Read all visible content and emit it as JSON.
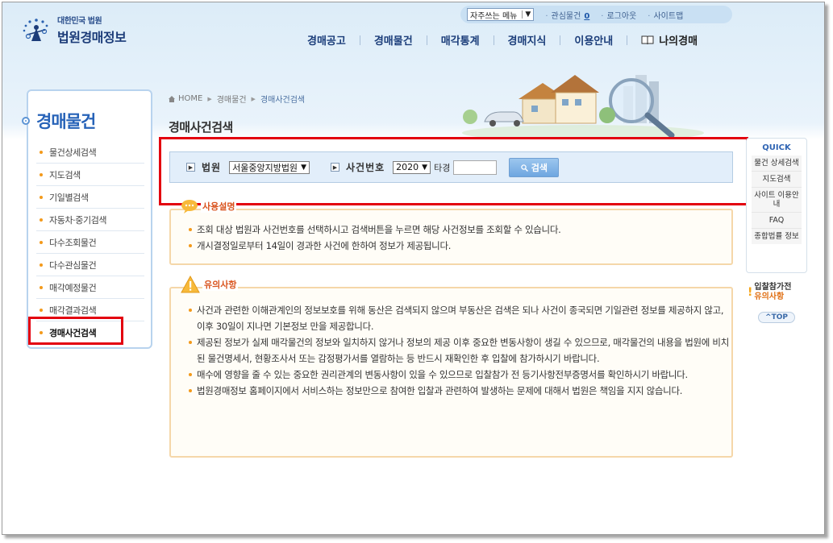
{
  "header": {
    "logo_sub": "대한민국 법원",
    "logo_main": "법원경매정보",
    "fav_menu": "자주쓰는 메뉴",
    "util": {
      "interest_label": "관심물건",
      "interest_count": "0",
      "login": "로그아웃",
      "sitemap": "사이트맵"
    },
    "gnb": [
      "경매공고",
      "경매물건",
      "매각통계",
      "경매지식",
      "이용안내",
      "나의경매"
    ]
  },
  "sidebar": {
    "title": "경매물건",
    "items": [
      "물건상세검색",
      "지도검색",
      "기일별검색",
      "자동차·중기검색",
      "다수조회물건",
      "다수관심물건",
      "매각예정물건",
      "매각결과검색",
      "경매사건검색"
    ],
    "active_index": 8
  },
  "breadcrumb": [
    "HOME",
    "경매물건",
    "경매사건검색"
  ],
  "page_title": "경매사건검색",
  "search": {
    "court_label": "법원",
    "court_value": "서울중앙지방법원",
    "case_label": "사건번호",
    "year_value": "2020",
    "case_type": "타경",
    "case_number": "",
    "button": "검색"
  },
  "usage": {
    "title": "사용설명",
    "items": [
      "조회 대상 법원과 사건번호를 선택하시고 검색버튼을 누르면 해당 사건정보를 조회할 수 있습니다.",
      "개시결정일로부터 14일이 경과한 사건에 한하여 정보가 제공됩니다."
    ]
  },
  "caution": {
    "title": "유의사항",
    "items": [
      "사건과 관련한 이해관계인의 정보보호를 위해 동산은 검색되지 않으며 부동산은 검색은 되나 사건이 종국되면 기일관련 정보를 제공하지 않고, 이후 30일이 지나면 기본정보 만을 제공합니다.",
      "제공된 정보가 실제 매각물건의 정보와 일치하지 않거나 정보의 제공 이후 중요한 변동사항이 생길 수 있으므로, 매각물건의 내용을 법원에 비치된 물건명세서, 현황조사서 또는 감정평가서를 열람하는 등 반드시 재확인한 후 입찰에 참가하시기 바랍니다.",
      "매수에 영향을 줄 수 있는 중요한 권리관계의 변동사항이 있을 수 있으므로 입찰참가 전 등기사항전부증명서를 확인하시기 바랍니다.",
      "법원경매정보 홈페이지에서 서비스하는 정보만으로 참여한 입찰과 관련하여 발생하는 문제에 대해서 법원은 책임을 지지 않습니다."
    ]
  },
  "quick": {
    "title": "QUICK",
    "items": [
      "물건 상세검색",
      "지도검색",
      "사이트 이용안내",
      "FAQ",
      "종합법률 정보"
    ],
    "notice_line1": "입찰참가전",
    "notice_line2": "유의사항",
    "top": "^TOP"
  },
  "colors": {
    "highlight": "#e3000f",
    "nav_blue": "#1b3d7a",
    "bullet_orange": "#f39a1b"
  }
}
